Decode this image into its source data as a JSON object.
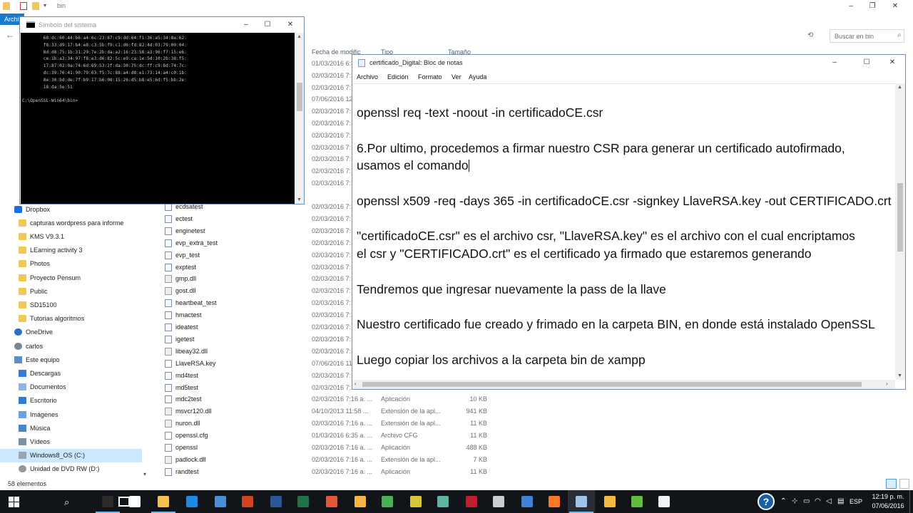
{
  "explorer": {
    "title": "bin",
    "ribbon_tab": "Archiv",
    "search_placeholder": "Buscar en bin",
    "columns": {
      "date": "Fecha de modific",
      "type": "Tipo",
      "size": "Tamaño"
    },
    "status_count": "58 elementos",
    "nav_items": [
      {
        "label": "Dropbox",
        "icon": "dropbox-icon"
      },
      {
        "label": "capturas wordpress para informe",
        "icon": "folder-icon"
      },
      {
        "label": "KMS V9.3.1",
        "icon": "folder-icon"
      },
      {
        "label": "LEarning activity 3",
        "icon": "folder-icon"
      },
      {
        "label": "Photos",
        "icon": "folder-icon"
      },
      {
        "label": "Proyecto Pensum",
        "icon": "folder-icon"
      },
      {
        "label": "Public",
        "icon": "folder-icon"
      },
      {
        "label": "SD15100",
        "icon": "folder-icon"
      },
      {
        "label": "Tutorias algoritmos",
        "icon": "folder-icon"
      },
      {
        "label": "OneDrive",
        "icon": "onedrive-icon"
      },
      {
        "label": "carlos",
        "icon": "user-icon"
      },
      {
        "label": "Este equipo",
        "icon": "computer-icon"
      },
      {
        "label": "Descargas",
        "icon": "downloads-icon"
      },
      {
        "label": "Documentos",
        "icon": "documents-icon"
      },
      {
        "label": "Escritorio",
        "icon": "desktop-icon"
      },
      {
        "label": "Imágenes",
        "icon": "pictures-icon"
      },
      {
        "label": "Música",
        "icon": "music-icon"
      },
      {
        "label": "Vídeos",
        "icon": "videos-icon"
      },
      {
        "label": "Windows8_OS (C:)",
        "icon": "drive-icon"
      },
      {
        "label": "Unidad de DVD RW (D:)",
        "icon": "dvd-drive-icon"
      }
    ],
    "dates_behind_windows": [
      "01/03/2016 6:35 a.",
      "02/03/2016 7:16 a.",
      "02/03/2016 7:16",
      "07/06/2016 12",
      "02/03/2016 7:16",
      "02/03/2016 7:16",
      "02/03/2016 7:16",
      "02/03/2016 7:16",
      "02/03/2016 7:16",
      "02/03/2016 7:16",
      "02/03/2016 7:16"
    ],
    "files": [
      {
        "name": "ecdsatest",
        "date": "02/03/2016 7:16",
        "type": "",
        "size": ""
      },
      {
        "name": "ectest",
        "date": "02/03/2016 7:16",
        "type": "",
        "size": ""
      },
      {
        "name": "enginetest",
        "date": "02/03/2016 7:16",
        "type": "",
        "size": ""
      },
      {
        "name": "evp_extra_test",
        "date": "02/03/2016 7:16",
        "type": "",
        "size": ""
      },
      {
        "name": "evp_test",
        "date": "02/03/2016 7:16",
        "type": "",
        "size": ""
      },
      {
        "name": "exptest",
        "date": "02/03/2016 7:16",
        "type": "",
        "size": ""
      },
      {
        "name": "gmp.dll",
        "date": "02/03/2016 7:16",
        "type": "",
        "size": ""
      },
      {
        "name": "gost.dll",
        "date": "02/03/2016 7:16",
        "type": "",
        "size": ""
      },
      {
        "name": "heartbeat_test",
        "date": "02/03/2016 7:16",
        "type": "",
        "size": ""
      },
      {
        "name": "hmactest",
        "date": "02/03/2016 7:16",
        "type": "",
        "size": ""
      },
      {
        "name": "ideatest",
        "date": "02/03/2016 7:16",
        "type": "",
        "size": ""
      },
      {
        "name": "igetest",
        "date": "02/03/2016 7:16",
        "type": "",
        "size": ""
      },
      {
        "name": "libeay32.dll",
        "date": "02/03/2016 7:16",
        "type": "",
        "size": ""
      },
      {
        "name": "LlaveRSA.key",
        "date": "07/06/2016 11",
        "type": "",
        "size": ""
      },
      {
        "name": "md4test",
        "date": "02/03/2016 7:16",
        "type": "",
        "size": ""
      },
      {
        "name": "md5test",
        "date": "02/03/2016 7:16",
        "type": "",
        "size": ""
      },
      {
        "name": "mdc2test",
        "date": "02/03/2016 7:16 a. ...",
        "type": "Aplicación",
        "size": "10 KB"
      },
      {
        "name": "msvcr120.dll",
        "date": "04/10/2013 11:58 ...",
        "type": "Extensión de la apl...",
        "size": "941 KB"
      },
      {
        "name": "nuron.dll",
        "date": "02/03/2016 7:16 a. ...",
        "type": "Extensión de la apl...",
        "size": "11 KB"
      },
      {
        "name": "openssl.cfg",
        "date": "01/03/2016 6:35 a. ...",
        "type": "Archivo CFG",
        "size": "11 KB"
      },
      {
        "name": "openssl",
        "date": "02/03/2016 7:16 a. ...",
        "type": "Aplicación",
        "size": "488 KB"
      },
      {
        "name": "padlock.dll",
        "date": "02/03/2016 7:16 a. ...",
        "type": "Extensión de la apl...",
        "size": "7 KB"
      },
      {
        "name": "randtest",
        "date": "02/03/2016 7:16 a. ...",
        "type": "Aplicación",
        "size": "11 KB"
      }
    ]
  },
  "cmd": {
    "title": "Símbolo del sistema",
    "lines": [
      "        68:dc:60:44:b6:a4:6c:23:87:c9:dd:64:f1:36:a5:34:8a:62:",
      "        f8:33:d9:17:b4:e8:c3:5b:f9:c1:d6:fd:82:4d:03:79:00:04:",
      "        8d:d8:75:1b:31:29:7e:2b:da:a2:16:23:58:a3:96:f7:15:e6:",
      "        ce:1b:a3:34:97:f8:e3:d6:82:5c:e9:ca:1e:5d:10:2b:38:f5:",
      "        17:87:02:0a:74:6d:69:53:2f:da:30:75:dc:ff:c9:8d:74:7c:",
      "        dc:39:76:41:90:79:63:f5:7c:88:a4:d8:e1:73:14:a4:c0:1b:",
      "        8e:30:bd:de:7f:b9:17:b6:08:15:26:d5:b8:e5:6d:f5:bb:2e:",
      "        18:da:5e:51",
      "",
      "C:\\OpenSSL-Win64\\bin>"
    ]
  },
  "notepad": {
    "title": "certificado_Digital: Bloc de notas",
    "menu": [
      "Archivo",
      "Edición",
      "Formato",
      "Ver",
      "Ayuda"
    ],
    "lines": [
      "openssl req -text -noout -in certificadoCE.csr",
      "6.Por ultimo, procedemos a firmar nuestro CSR para generar un certificado autofirmado,",
      "usamos el comando",
      "openssl x509 -req -days 365 -in certificadoCE.csr -signkey LlaveRSA.key -out CERTIFICADO.crt",
      "\"certificadoCE.csr\" es el archivo csr, \"LlaveRSA.key\" es el archivo con el cual encriptamos",
      "el csr y \"CERTIFICADO.crt\" es el certificado ya firmado que estaremos generando",
      "Tendremos que ingresar nuevamente la pass de la llave",
      "Nuestro certificado fue creado y frimado en la carpeta BIN, en donde está instalado OpenSSL",
      "Luego copiar los archivos a la carpeta bin de xampp"
    ]
  },
  "taskbar": {
    "language": "ESP",
    "time": "12:19 p. m.",
    "date": "07/06/2016",
    "apps": [
      {
        "name": "cmd-app",
        "color": "#2b2b2b"
      },
      {
        "name": "store-app",
        "color": "#ffffff"
      },
      {
        "name": "explorer-app",
        "color": "#f2c14e"
      },
      {
        "name": "edge-app",
        "color": "#1e88e5"
      },
      {
        "name": "virtualbox-app",
        "color": "#4a90d9"
      },
      {
        "name": "powerpoint-app",
        "color": "#d04423"
      },
      {
        "name": "word-app",
        "color": "#2b579a"
      },
      {
        "name": "excel-app",
        "color": "#217346"
      },
      {
        "name": "game-app",
        "color": "#e0583a"
      },
      {
        "name": "sublime-app",
        "color": "#f7b343"
      },
      {
        "name": "chrome-app",
        "color": "#4caf50"
      },
      {
        "name": "jdownloader-app",
        "color": "#d6c43a"
      },
      {
        "name": "gitkraken-app",
        "color": "#5fb3a3"
      },
      {
        "name": "filezilla-app",
        "color": "#bf1e2e"
      },
      {
        "name": "inkscape-app",
        "color": "#cccccc"
      },
      {
        "name": "app-blue",
        "color": "#3f7fd6"
      },
      {
        "name": "xampp-app",
        "color": "#fb7a24"
      },
      {
        "name": "notepad-app",
        "color": "#9fc3e9"
      },
      {
        "name": "media-app",
        "color": "#f4b942"
      },
      {
        "name": "camtasia-app",
        "color": "#5fbf3a"
      },
      {
        "name": "app-white",
        "color": "#f2f2f2"
      }
    ]
  }
}
